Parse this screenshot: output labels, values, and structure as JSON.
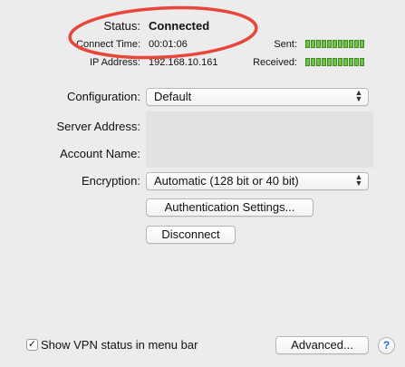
{
  "status": {
    "label": "Status:",
    "value": "Connected",
    "connect_time_label": "Connect Time:",
    "connect_time_value": "00:01:06",
    "ip_label": "IP Address:",
    "ip_value": "192.168.10.161",
    "sent_label": "Sent:",
    "received_label": "Received:",
    "meter_color": "#6fc442"
  },
  "form": {
    "configuration_label": "Configuration:",
    "configuration_value": "Default",
    "server_label": "Server Address:",
    "account_label": "Account Name:",
    "encryption_label": "Encryption:",
    "encryption_value": "Automatic (128 bit or 40 bit)"
  },
  "buttons": {
    "authentication": "Authentication Settings...",
    "disconnect": "Disconnect",
    "advanced": "Advanced...",
    "help": "?"
  },
  "footer": {
    "show_vpn_label": "Show VPN status in menu bar",
    "show_vpn_checked": true
  },
  "annotation": {
    "circle_color": "#e8463a"
  }
}
